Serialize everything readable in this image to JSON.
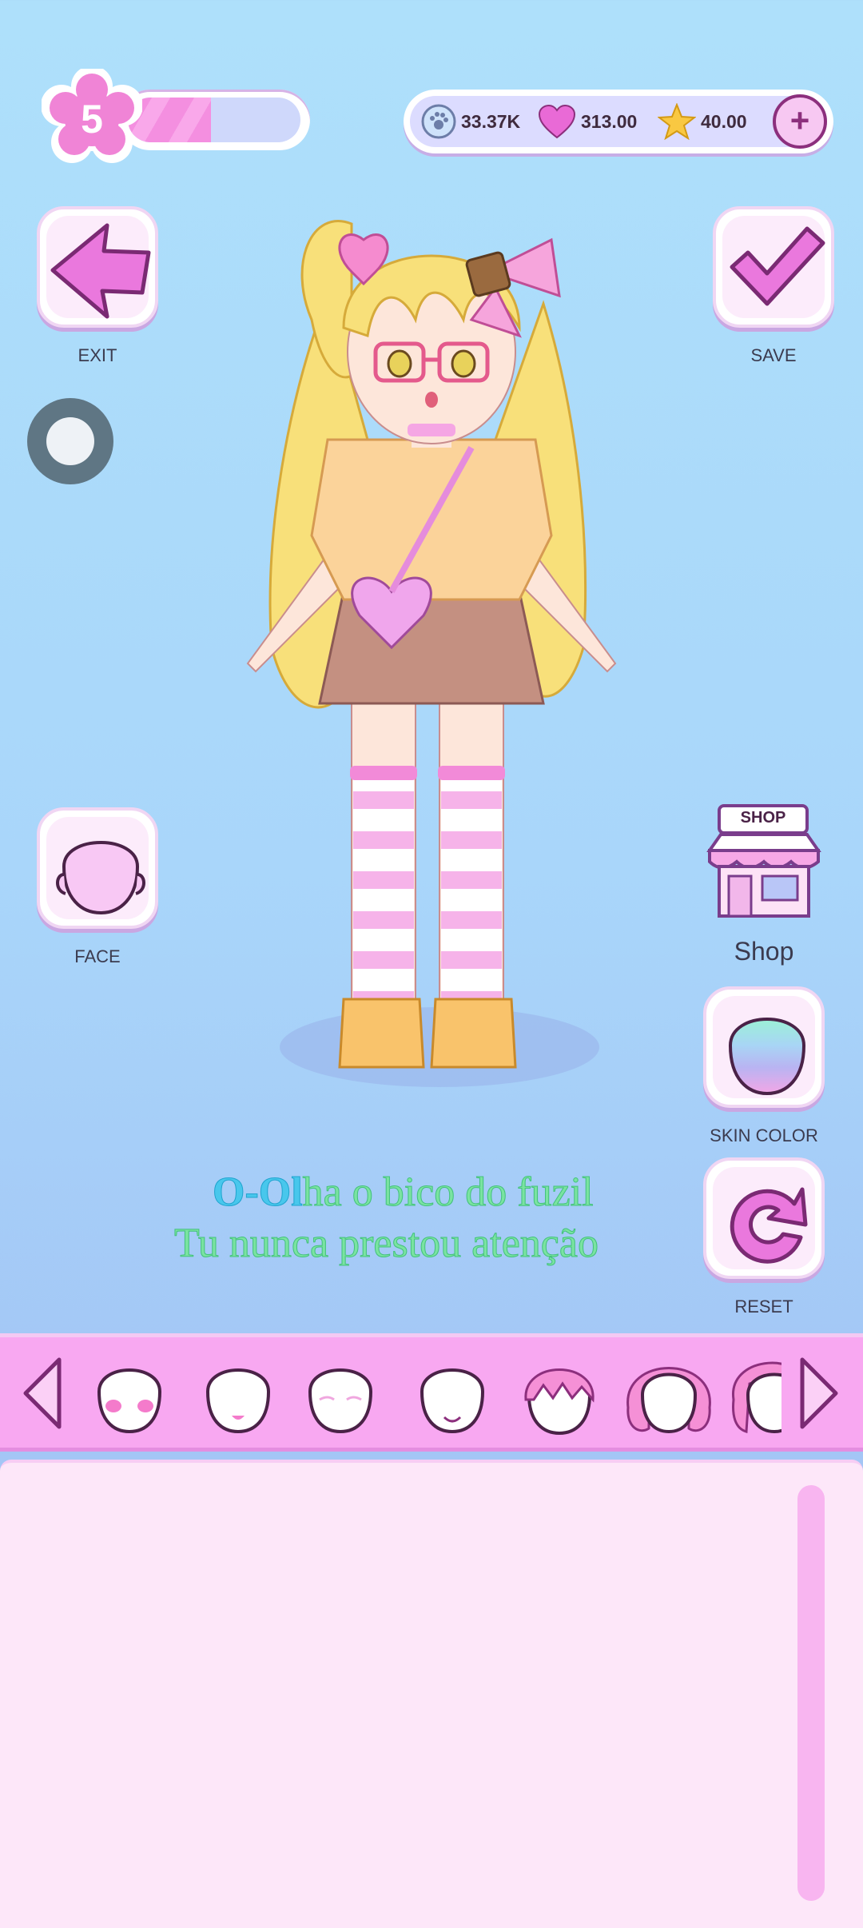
{
  "header": {
    "level": "5",
    "xp_progress": 0.48,
    "currencies": [
      {
        "icon": "paw-coin-icon",
        "value": "33.37K"
      },
      {
        "icon": "heart-icon",
        "value": "313.00"
      },
      {
        "icon": "star-icon",
        "value": "40.00"
      }
    ],
    "add_icon": "plus-icon"
  },
  "buttons": {
    "exit_label": "EXIT",
    "save_label": "SAVE",
    "face_label": "FACE",
    "shop_sign": "SHOP",
    "shop_label": "Shop",
    "skin_color_label": "SKIN COLOR",
    "reset_label": "RESET"
  },
  "lyrics": {
    "line1_highlight": "O-Ol",
    "line1_rest": "ha o bico do fuzil",
    "line2": "Tu nunca prestou atenção"
  },
  "item_bar": {
    "items": [
      "face-blush",
      "face-mouth",
      "face-closed-eyes",
      "face-smile",
      "hair-short-pink",
      "hair-bob-pink",
      "hair-side-pink"
    ]
  },
  "colors": {
    "accent_pink": "#f8a8f1",
    "dark_purple": "#8c2f7d",
    "sky_blue": "#aee0fb"
  }
}
